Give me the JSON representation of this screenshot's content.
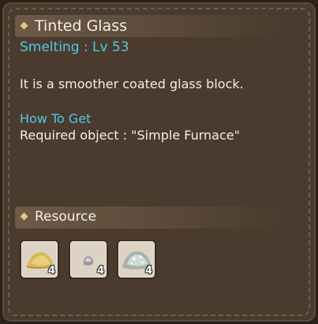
{
  "item": {
    "title": "Tinted Glass",
    "category": "Smelting : Lv 53",
    "description": "It is a smoother coated glass block."
  },
  "acquire": {
    "heading": "How To Get",
    "requirement": "Required object : \"Simple Furnace\""
  },
  "resources": {
    "heading": "Resource",
    "items": [
      {
        "icon": "sand-pile-icon",
        "count": "4"
      },
      {
        "icon": "stone-pebble-icon",
        "count": "4"
      },
      {
        "icon": "quartz-dust-pile-icon",
        "count": "4"
      }
    ]
  },
  "colors": {
    "accent_cyan": "#4ec9e6",
    "panel_bg": "#4a3b2e",
    "bullet_gold": "#e7c67f"
  }
}
